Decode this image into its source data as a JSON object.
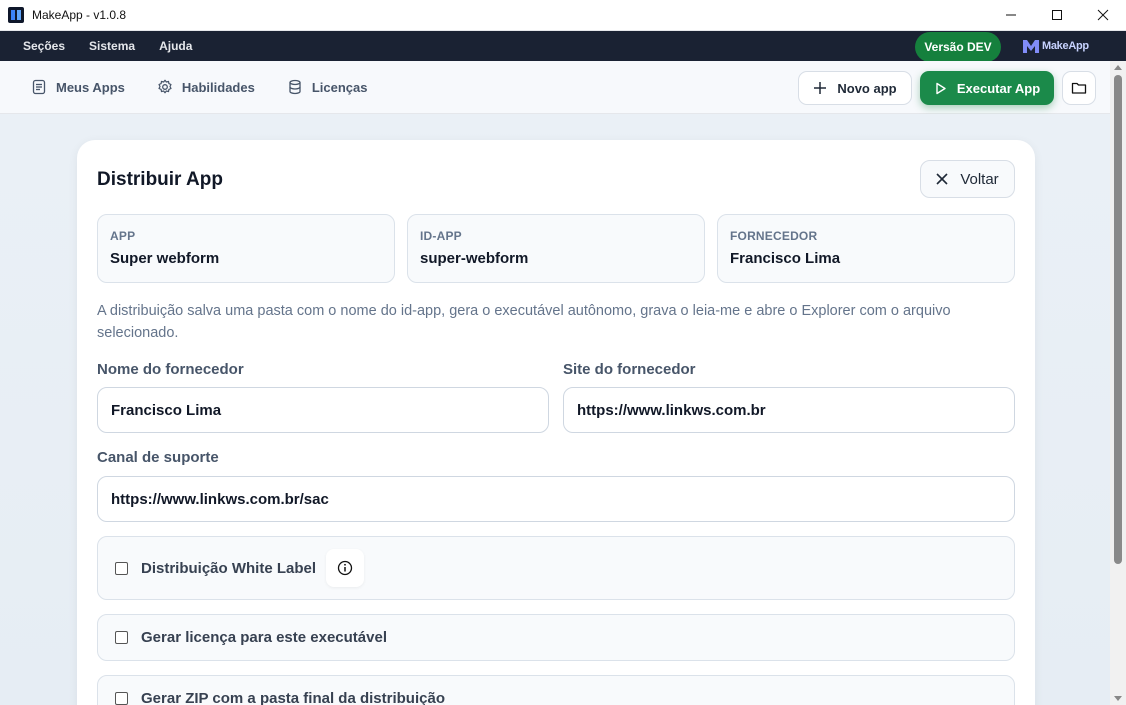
{
  "window": {
    "title": "MakeApp - v1.0.8"
  },
  "menu": {
    "items": [
      "Seções",
      "Sistema",
      "Ajuda"
    ],
    "dev_badge": "Versão DEV",
    "brand": "MakeApp"
  },
  "toolbar": {
    "nav": [
      {
        "label": "Meus Apps",
        "icon": "document-icon"
      },
      {
        "label": "Habilidades",
        "icon": "gear-icon"
      },
      {
        "label": "Licenças",
        "icon": "database-icon"
      }
    ],
    "new_app": "Novo app",
    "run_app": "Executar App"
  },
  "card": {
    "title": "Distribuir App",
    "back": "Voltar",
    "info": [
      {
        "label": "APP",
        "value": "Super webform"
      },
      {
        "label": "ID-APP",
        "value": "super-webform"
      },
      {
        "label": "FORNECEDOR",
        "value": "Francisco Lima"
      }
    ],
    "description": "A distribuição salva uma pasta com o nome do id-app, gera o executável autônomo, grava o leia-me e abre o Explorer com o arquivo selecionado.",
    "fields": {
      "vendor_name": {
        "label": "Nome do fornecedor",
        "value": "Francisco Lima"
      },
      "vendor_site": {
        "label": "Site do fornecedor",
        "value": "https://www.linkws.com.br"
      },
      "support": {
        "label": "Canal de suporte",
        "value": "https://www.linkws.com.br/sac"
      }
    },
    "options": [
      {
        "label": "Distribuição White Label",
        "checked": false
      },
      {
        "label": "Gerar licença para este executável",
        "checked": false
      },
      {
        "label": "Gerar ZIP com a pasta final da distribuição",
        "checked": false
      }
    ]
  },
  "colors": {
    "accent_green": "#1b8a4a",
    "menubar": "#1a2233",
    "dev_badge": "#15803d"
  }
}
